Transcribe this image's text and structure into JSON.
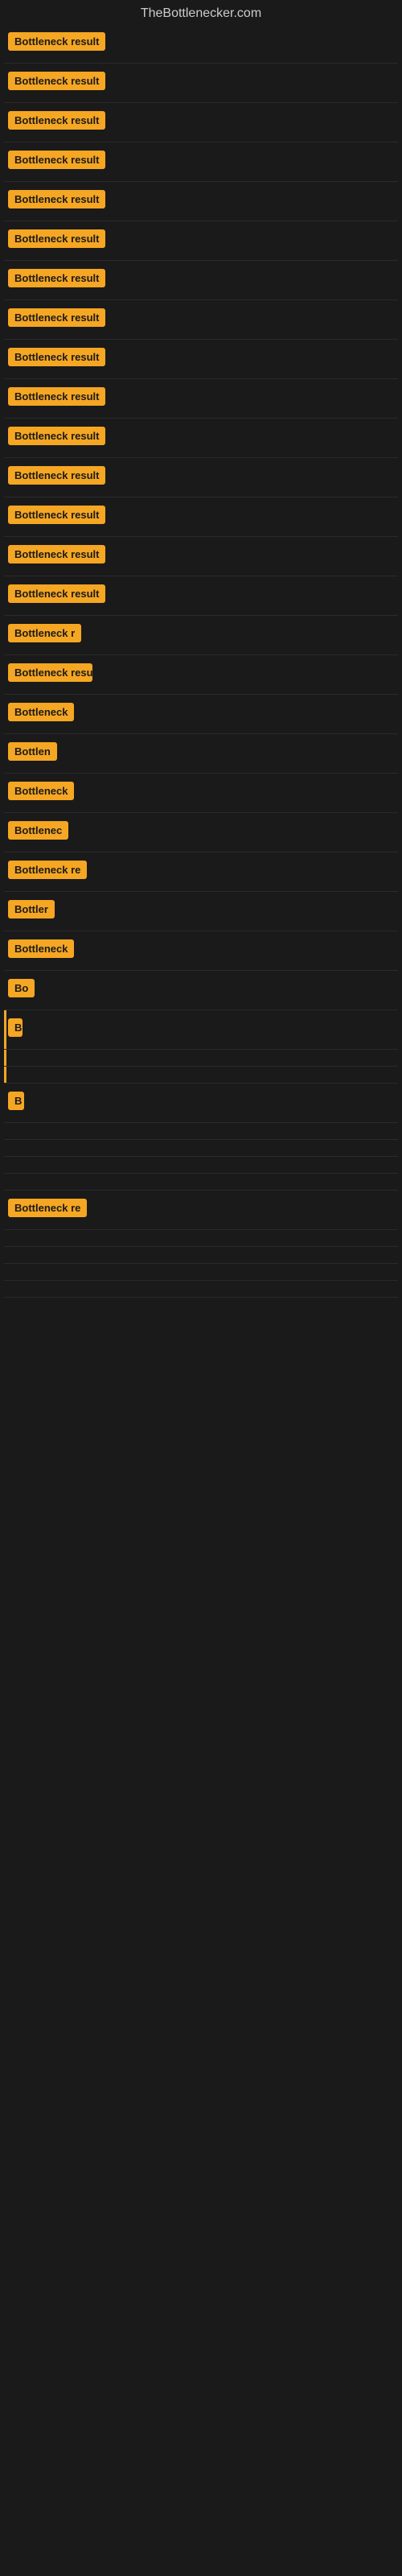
{
  "site": {
    "title": "TheBottlenecker.com"
  },
  "items": [
    {
      "id": 1,
      "label": "Bottleneck result"
    },
    {
      "id": 2,
      "label": "Bottleneck result"
    },
    {
      "id": 3,
      "label": "Bottleneck result"
    },
    {
      "id": 4,
      "label": "Bottleneck result"
    },
    {
      "id": 5,
      "label": "Bottleneck result"
    },
    {
      "id": 6,
      "label": "Bottleneck result"
    },
    {
      "id": 7,
      "label": "Bottleneck result"
    },
    {
      "id": 8,
      "label": "Bottleneck result"
    },
    {
      "id": 9,
      "label": "Bottleneck result"
    },
    {
      "id": 10,
      "label": "Bottleneck result"
    },
    {
      "id": 11,
      "label": "Bottleneck result"
    },
    {
      "id": 12,
      "label": "Bottleneck result"
    },
    {
      "id": 13,
      "label": "Bottleneck result"
    },
    {
      "id": 14,
      "label": "Bottleneck result"
    },
    {
      "id": 15,
      "label": "Bottleneck result"
    },
    {
      "id": 16,
      "label": "Bottleneck r"
    },
    {
      "id": 17,
      "label": "Bottleneck resu"
    },
    {
      "id": 18,
      "label": "Bottleneck"
    },
    {
      "id": 19,
      "label": "Bottlen"
    },
    {
      "id": 20,
      "label": "Bottleneck"
    },
    {
      "id": 21,
      "label": "Bottlenec"
    },
    {
      "id": 22,
      "label": "Bottleneck re"
    },
    {
      "id": 23,
      "label": "Bottler"
    },
    {
      "id": 24,
      "label": "Bottleneck"
    },
    {
      "id": 25,
      "label": "Bo"
    },
    {
      "id": 26,
      "label": "B"
    },
    {
      "id": 27,
      "label": ""
    },
    {
      "id": 28,
      "label": ""
    },
    {
      "id": 29,
      "label": "B"
    },
    {
      "id": 30,
      "label": ""
    },
    {
      "id": 31,
      "label": ""
    },
    {
      "id": 32,
      "label": ""
    },
    {
      "id": 33,
      "label": ""
    },
    {
      "id": 34,
      "label": "Bottleneck re"
    },
    {
      "id": 35,
      "label": ""
    },
    {
      "id": 36,
      "label": ""
    },
    {
      "id": 37,
      "label": ""
    },
    {
      "id": 38,
      "label": ""
    }
  ]
}
